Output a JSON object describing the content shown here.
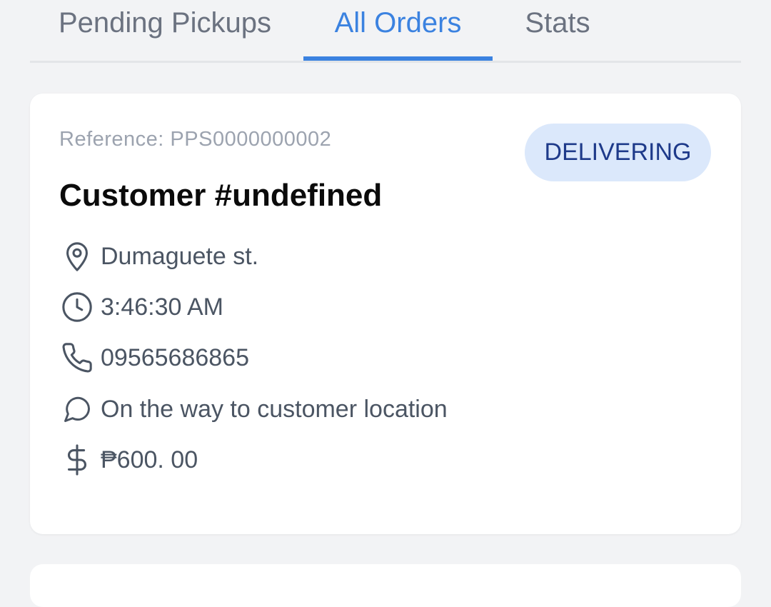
{
  "tabs": [
    {
      "label": "Pending Pickups"
    },
    {
      "label": "All Orders"
    },
    {
      "label": "Stats"
    }
  ],
  "order": {
    "reference": "Reference: PPS0000000002",
    "status": "DELIVERING",
    "customer": "Customer #undefined",
    "address": "Dumaguete st.",
    "time": "3:46:30 AM",
    "phone": "09565686865",
    "note": "On the way to customer location",
    "amount": "₱600. 00"
  },
  "colors": {
    "accent": "#3b82e0",
    "badge_bg": "#dbe8fb",
    "badge_text": "#1e3a8a",
    "background": "#f2f3f5"
  },
  "icons": {
    "address": "map-pin-icon",
    "time": "clock-icon",
    "phone": "phone-icon",
    "note": "message-circle-icon",
    "amount": "dollar-sign-icon"
  }
}
